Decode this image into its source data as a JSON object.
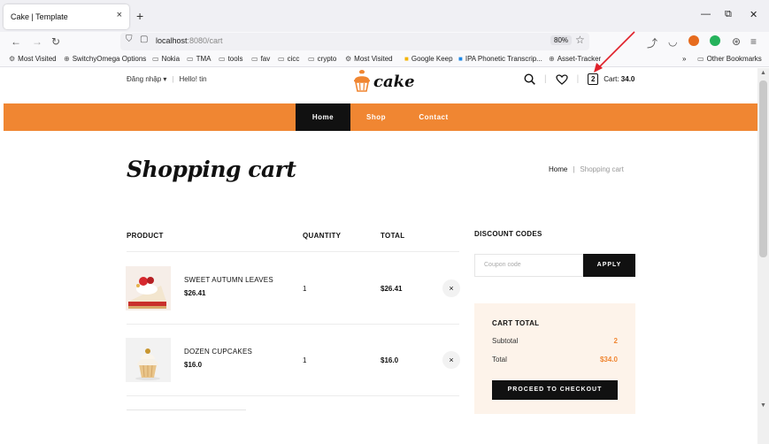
{
  "browser": {
    "tab_title": "Cake | Template",
    "tab_close": "×",
    "new_tab": "+",
    "url_host": "localhost",
    "url_path": ":8080/cart",
    "zoom": "80%",
    "window_controls": {
      "minimize": "—",
      "restore": "⧉",
      "close": "✕"
    },
    "bookmarks": [
      {
        "icon": "gear-icon",
        "label": "Most Visited"
      },
      {
        "icon": "globe-icon",
        "label": "SwitchyOmega Options"
      },
      {
        "icon": "folder-icon",
        "label": "Nokia"
      },
      {
        "icon": "folder-icon",
        "label": "TMA"
      },
      {
        "icon": "folder-icon",
        "label": "tools"
      },
      {
        "icon": "folder-icon",
        "label": "fav"
      },
      {
        "icon": "folder-icon",
        "label": "cicc"
      },
      {
        "icon": "folder-icon",
        "label": "crypto"
      },
      {
        "icon": "gear-icon",
        "label": "Most Visited"
      },
      {
        "icon": "keep-icon",
        "label": "Google Keep"
      },
      {
        "icon": "ipa-icon",
        "label": "IPA Phonetic Transcrip..."
      },
      {
        "icon": "globe-icon",
        "label": "Asset-Tracker"
      }
    ],
    "overflow": "»",
    "other_bookmarks": "Other Bookmarks"
  },
  "header": {
    "login": "Đăng nhập",
    "greeting": "Hello!  tin",
    "logo_text": "cake",
    "cart_count": "2",
    "cart_label": "Cart:",
    "cart_value": "34.0"
  },
  "menu": {
    "items": [
      "Home",
      "Shop",
      "Contact"
    ]
  },
  "page": {
    "title": "Shopping cart",
    "breadcrumb_home": "Home",
    "breadcrumb_current": "Shopping cart"
  },
  "table": {
    "headers": {
      "product": "PRODUCT",
      "quantity": "QUANTITY",
      "total": "TOTAL"
    },
    "rows": [
      {
        "name": "SWEET AUTUMN LEAVES",
        "price": "$26.41",
        "quantity": "1",
        "total": "$26.41",
        "remove": "×"
      },
      {
        "name": "DOZEN CUPCAKES",
        "price": "$16.0",
        "quantity": "1",
        "total": "$16.0",
        "remove": "×"
      }
    ]
  },
  "discount": {
    "title": "DISCOUNT CODES",
    "placeholder": "Coupon code",
    "apply": "APPLY"
  },
  "cart_total": {
    "title": "CART TOTAL",
    "subtotal_label": "Subtotal",
    "subtotal_value": "2",
    "total_label": "Total",
    "total_value": "$34.0",
    "checkout": "PROCEED TO CHECKOUT"
  },
  "colors": {
    "accent": "#f08632",
    "dark": "#111111",
    "cart_total_bg": "#fdf3ea",
    "annotation_arrow": "#e0202a"
  }
}
